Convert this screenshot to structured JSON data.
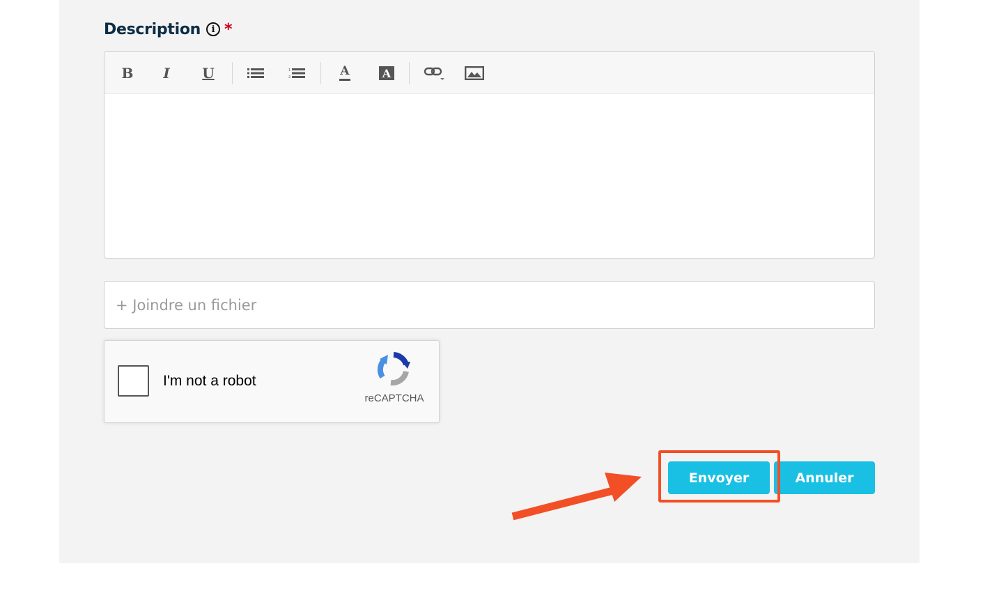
{
  "form": {
    "description_label": "Description",
    "info_icon_glyph": "i",
    "required_mark": "*",
    "editor_content": "",
    "toolbar": [
      {
        "name": "bold",
        "glyph": "B"
      },
      {
        "name": "italic",
        "glyph": "I"
      },
      {
        "name": "underline",
        "glyph": "U"
      },
      {
        "name": "bullet-list",
        "icon": "bullet-list-icon"
      },
      {
        "name": "numbered-list",
        "icon": "numbered-list-icon"
      },
      {
        "name": "text-color",
        "glyph": "A"
      },
      {
        "name": "background-color",
        "glyph": "A"
      },
      {
        "name": "link",
        "icon": "link-icon"
      },
      {
        "name": "image",
        "icon": "image-icon"
      }
    ],
    "attach_label": "+ Joindre un fichier",
    "recaptcha": {
      "label": "I'm not a robot",
      "brand": "reCAPTCHA"
    },
    "buttons": {
      "send": "Envoyer",
      "cancel": "Annuler"
    }
  },
  "colors": {
    "accent": "#19c0e3",
    "highlight": "#f24f27",
    "label": "#0d2d44",
    "required": "#d0021b",
    "panel": "#f3f3f3"
  }
}
